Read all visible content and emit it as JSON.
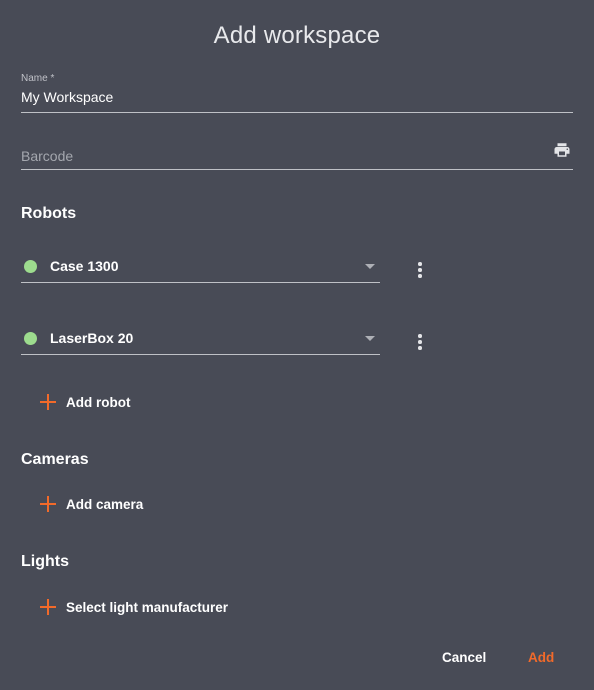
{
  "dialog": {
    "title": "Add workspace"
  },
  "form": {
    "name": {
      "label": "Name *",
      "value": "My Workspace"
    },
    "barcode": {
      "placeholder": "Barcode",
      "icon": "print-icon"
    }
  },
  "robots": {
    "title": "Robots",
    "items": [
      {
        "label": "Case 1300",
        "status_color": "#9ddc8e"
      },
      {
        "label": "LaserBox 20",
        "status_color": "#9ddc8e"
      }
    ],
    "add_label": "Add robot"
  },
  "cameras": {
    "title": "Cameras",
    "add_label": "Add camera"
  },
  "lights": {
    "title": "Lights",
    "add_label": "Select light manufacturer"
  },
  "actions": {
    "cancel_label": "Cancel",
    "add_label": "Add"
  },
  "colors": {
    "accent": "#f26a2a",
    "background": "#484b56",
    "status_ok": "#9ddc8e"
  }
}
